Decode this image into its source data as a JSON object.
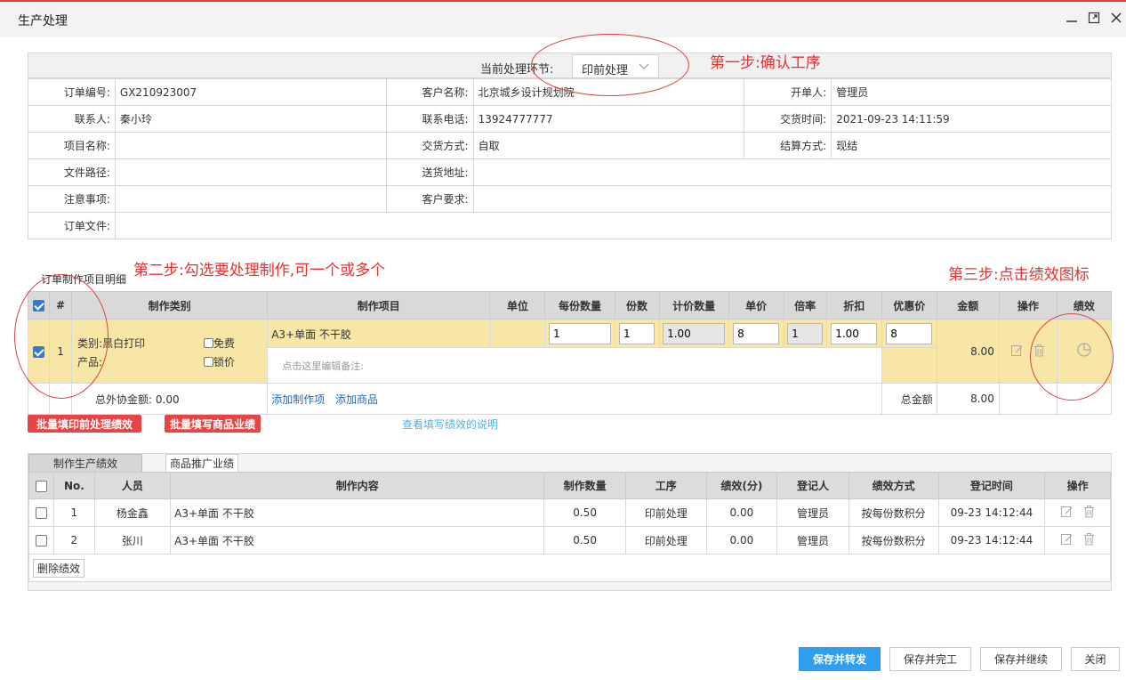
{
  "window": {
    "title": "生产处理"
  },
  "stage": {
    "label": "当前处理环节:",
    "value": "印前处理"
  },
  "annotations": {
    "step1": "第一步:确认工序",
    "step2": "第二步:勾选要处理制作,可一个或多个",
    "step3": "第三步:点击绩效图标"
  },
  "order": {
    "rows": [
      [
        {
          "label": "订单编号:",
          "value": "GX210923007"
        },
        {
          "label": "客户名称:",
          "value": "北京城乡设计规划院"
        },
        {
          "label": "开单人:",
          "value": "管理员"
        }
      ],
      [
        {
          "label": "联系人:",
          "value": "秦小玲"
        },
        {
          "label": "联系电话:",
          "value": "13924777777"
        },
        {
          "label": "交货时间:",
          "value": "2021-09-23 14:11:59"
        }
      ],
      [
        {
          "label": "项目名称:",
          "value": ""
        },
        {
          "label": "交货方式:",
          "value": "自取"
        },
        {
          "label": "结算方式:",
          "value": "现结"
        }
      ],
      [
        {
          "label": "文件路径:",
          "value": ""
        },
        {
          "label": "送货地址:",
          "value": ""
        }
      ],
      [
        {
          "label": "注意事项:",
          "value": ""
        },
        {
          "label": "客户要求:",
          "value": ""
        }
      ],
      [
        {
          "label": "订单文件:",
          "value": ""
        }
      ]
    ]
  },
  "items": {
    "section_title": "订单制作项目明细",
    "headers": [
      "#",
      "制作类别",
      "制作项目",
      "单位",
      "每份数量",
      "份数",
      "计价数量",
      "单价",
      "倍率",
      "折扣",
      "优惠价",
      "金额",
      "操作",
      "绩效"
    ],
    "row": {
      "index": "1",
      "category": "类别:黑白打印",
      "product": "产品:",
      "free_label": "免费",
      "lock_label": "锁价",
      "item": "A3+单面 不干胶",
      "unit": "",
      "per_qty": "1",
      "copies": "1",
      "pricing_qty": "1.00",
      "unit_price": "8",
      "ratio": "1",
      "discount": "1.00",
      "special_price": "8",
      "amount": "8.00",
      "note_placeholder": "点击这里编辑备注:"
    },
    "footer": {
      "outsource_label": "总外协金额:",
      "outsource_value": "0.00",
      "add_item": "添加制作项",
      "add_product": "添加商品",
      "total_label": "总金额",
      "total_value": "8.00"
    },
    "icons": {
      "edit": "edit-icon",
      "delete": "trash-icon",
      "perf": "pie-chart-icon"
    }
  },
  "actions": {
    "batch_prepress": "批量填印前处理绩效",
    "batch_sales": "批量填写商品业绩",
    "help_link": "查看填写绩效的说明"
  },
  "performance": {
    "tabs": [
      "制作生产绩效",
      "商品推广业绩"
    ],
    "headers": [
      "No.",
      "人员",
      "制作内容",
      "制作数量",
      "工序",
      "绩效(分)",
      "登记人",
      "绩效方式",
      "登记时间",
      "操作"
    ],
    "rows": [
      {
        "no": "1",
        "person": "杨金鑫",
        "content": "A3+单面 不干胶",
        "qty": "0.50",
        "process": "印前处理",
        "score": "0.00",
        "registrar": "管理员",
        "method": "按每份数积分",
        "time": "09-23 14:12:44"
      },
      {
        "no": "2",
        "person": "张川",
        "content": "A3+单面 不干胶",
        "qty": "0.50",
        "process": "印前处理",
        "score": "0.00",
        "registrar": "管理员",
        "method": "按每份数积分",
        "time": "09-23 14:12:44"
      }
    ],
    "delete_button": "删除绩效"
  },
  "footer_buttons": {
    "save_forward": "保存并转发",
    "save_complete": "保存并完工",
    "save_continue": "保存并继续",
    "close": "关闭"
  },
  "colors": {
    "accent_blue": "#2d9ef0",
    "danger_red": "#e54545",
    "annotation_red": "#e8312f",
    "highlight_yellow": "#f7e6a6"
  }
}
